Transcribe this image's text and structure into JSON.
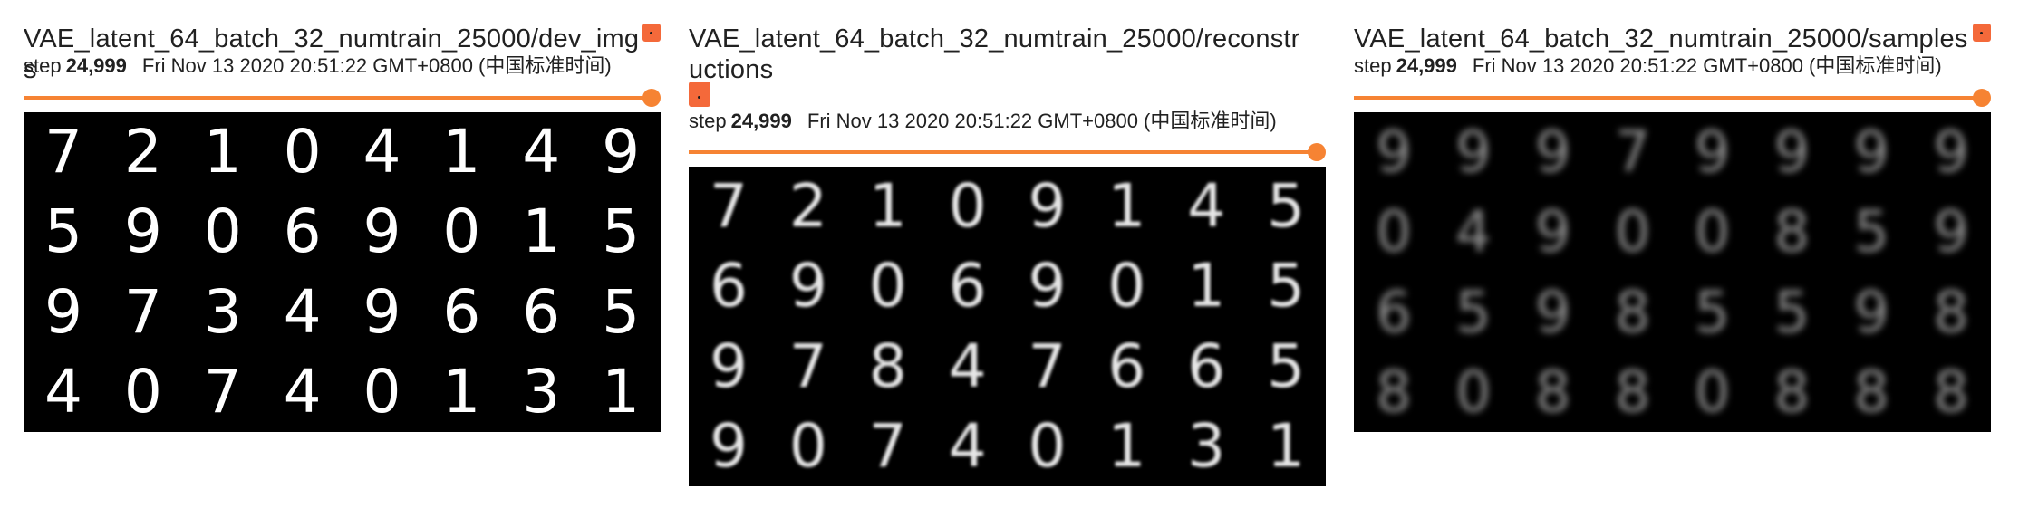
{
  "cards": [
    {
      "title": "VAE_latent_64_batch_32_numtrain_25000/dev_imgs",
      "step_label": "step",
      "step_value": "24,999",
      "timestamp": "Fri Nov 13 2020 20:51:22 GMT+0800 (中国标准时间)",
      "slider_fraction": 1.0,
      "image_kind": "original",
      "digits": [
        "7",
        "2",
        "1",
        "0",
        "4",
        "1",
        "4",
        "9",
        "5",
        "9",
        "0",
        "6",
        "9",
        "0",
        "1",
        "5",
        "9",
        "7",
        "3",
        "4",
        "9",
        "6",
        "6",
        "5",
        "4",
        "0",
        "7",
        "4",
        "0",
        "1",
        "3",
        "1"
      ]
    },
    {
      "title": "VAE_latent_64_batch_32_numtrain_25000/reconstructions",
      "step_label": "step",
      "step_value": "24,999",
      "timestamp": "Fri Nov 13 2020 20:51:22 GMT+0800 (中国标准时间)",
      "slider_fraction": 1.0,
      "image_kind": "reconstruction",
      "digits": [
        "7",
        "2",
        "1",
        "0",
        "9",
        "1",
        "4",
        "5",
        "6",
        "9",
        "0",
        "6",
        "9",
        "0",
        "1",
        "5",
        "9",
        "7",
        "8",
        "4",
        "7",
        "6",
        "6",
        "5",
        "9",
        "0",
        "7",
        "4",
        "0",
        "1",
        "3",
        "1"
      ]
    },
    {
      "title": "VAE_latent_64_batch_32_numtrain_25000/samples",
      "step_label": "step",
      "step_value": "24,999",
      "timestamp": "Fri Nov 13 2020 20:51:22 GMT+0800 (中国标准时间)",
      "slider_fraction": 1.0,
      "image_kind": "sample",
      "digits": [
        "9",
        "9",
        "9",
        "7",
        "9",
        "9",
        "9",
        "9",
        "0",
        "4",
        "9",
        "0",
        "0",
        "8",
        "5",
        "9",
        "6",
        "5",
        "9",
        "8",
        "5",
        "5",
        "9",
        "8",
        "8",
        "0",
        "8",
        "8",
        "0",
        "8",
        "8",
        "8"
      ]
    }
  ],
  "colors": {
    "accent": "#f68333",
    "corner_button": "#f4693a",
    "image_background": "#000000"
  }
}
